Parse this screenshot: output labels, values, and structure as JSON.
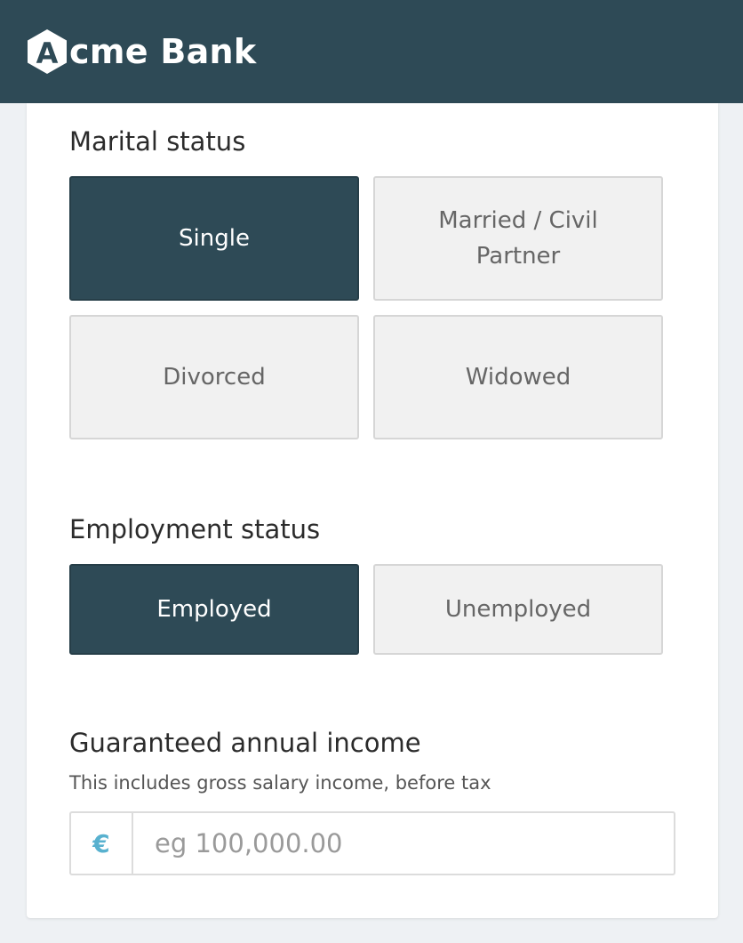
{
  "header": {
    "logo_letter": "A",
    "brand_rest": "cme Bank"
  },
  "marital": {
    "title": "Marital status",
    "options": [
      {
        "label": "Single",
        "selected": true
      },
      {
        "label": "Married / Civil Partner",
        "selected": false
      },
      {
        "label": "Divorced",
        "selected": false
      },
      {
        "label": "Widowed",
        "selected": false
      }
    ]
  },
  "employment": {
    "title": "Employment status",
    "options": [
      {
        "label": "Employed",
        "selected": true
      },
      {
        "label": "Unemployed",
        "selected": false
      }
    ]
  },
  "income": {
    "title": "Guaranteed annual income",
    "subtitle": "This includes gross salary income, before tax",
    "currency_symbol": "€",
    "value": "",
    "placeholder": "eg 100,000.00"
  },
  "colors": {
    "header_bg": "#2e4a56",
    "selected_bg": "#2e4a56",
    "unselected_bg": "#f1f1f1",
    "currency_accent": "#58b1cf"
  }
}
